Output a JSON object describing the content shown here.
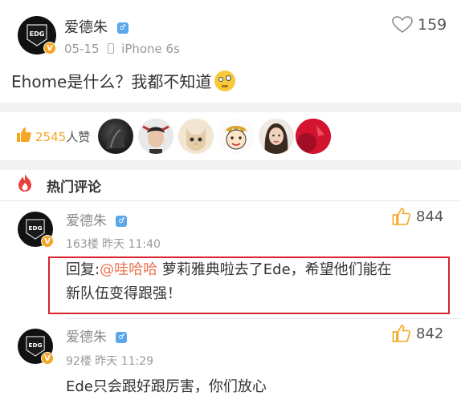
{
  "post": {
    "author": "爱德朱",
    "date": "05-15",
    "device": "iPhone 6s",
    "like_count": "159",
    "text": "Ehome是什么？我都不知道",
    "avatar_label": "EDG",
    "verified_badge": "V"
  },
  "likes": {
    "count": "2545",
    "unit": "人赞"
  },
  "hot_comments": {
    "title": "热门评论"
  },
  "comments": [
    {
      "author": "爱德朱",
      "floor_time": "163楼  昨天 11:40",
      "likes": "844",
      "reply_prefix": "回复:",
      "mention": "@哇哈哈",
      "text_line1": " 萝莉雅典啦去了Ede，希望他们能在",
      "text_line2": "新队伍变得跟强！"
    },
    {
      "author": "爱德朱",
      "floor_time": "92楼  昨天 11:29",
      "likes": "842",
      "text": "Ede只会跟好跟厉害，你们放心"
    }
  ],
  "colors": {
    "accent_orange": "#f5a623",
    "mention": "#eb7350",
    "highlight_border": "#d9232d",
    "hot_icon": "#e8413b"
  }
}
